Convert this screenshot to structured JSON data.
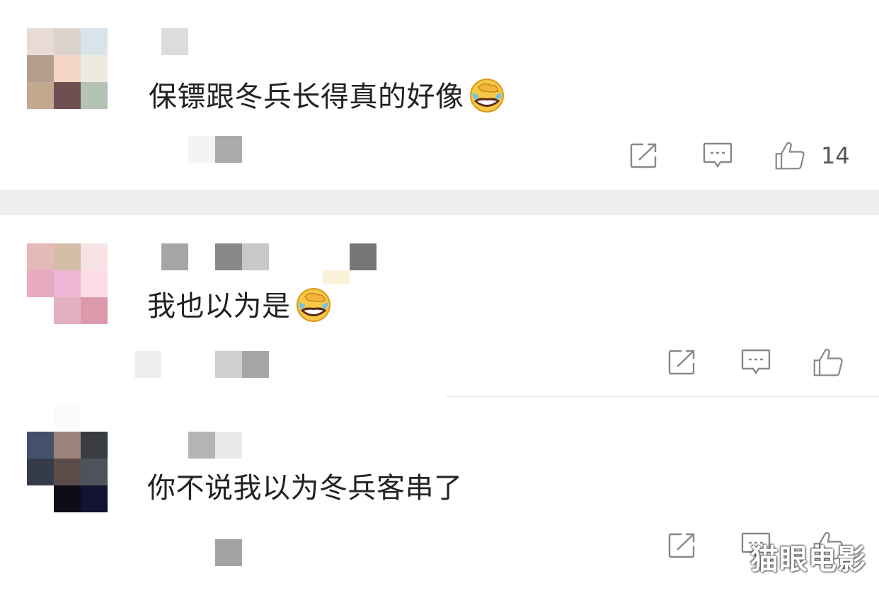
{
  "comments": [
    {
      "text": "保镖跟冬兵长得真的好像",
      "emoji": "laughing-crying-emoji",
      "like_count": "14",
      "avatar_colors": [
        "#e8dbd6",
        "#dbd2cd",
        "#d9e4ea",
        "#b49e8e",
        "#f3d5c4",
        "#edebe0",
        "#c3aa8f",
        "#704f52",
        "#b5c3b4"
      ]
    },
    {
      "text": "我也以为是",
      "emoji": "laughing-crying-emoji",
      "like_count": "",
      "avatar_colors": [
        "#e5b8b9",
        "#d6bda8",
        "#f6e3e6",
        "#e7aac0",
        "#efb7d5",
        "#fbdde7",
        "#ffffff",
        "#e2b0c0",
        "#db9aab"
      ]
    },
    {
      "text": "你不说我以为冬兵客串了",
      "emoji": "",
      "like_count": "",
      "avatar_colors": [
        "#44516b",
        "#9d837a",
        "#393c41",
        "#353b4b",
        "#5a4c48",
        "#4f525a",
        "#ffffff",
        "#0d0d17",
        "#121330"
      ]
    }
  ],
  "watermark": "猫眼电影",
  "colors": {
    "icon": "#888888",
    "separator": "#efefef",
    "text": "#222222"
  }
}
